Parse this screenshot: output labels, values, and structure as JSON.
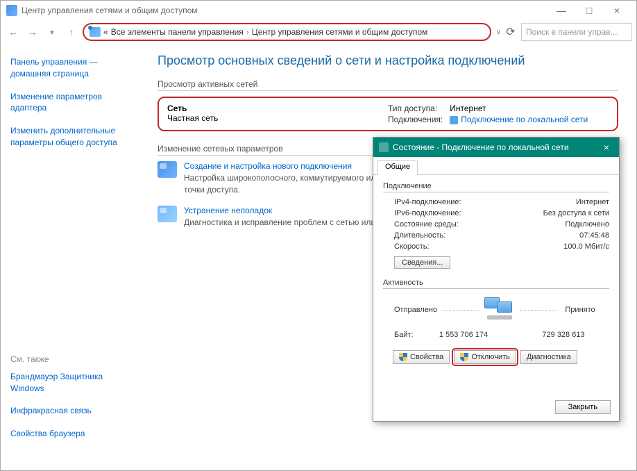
{
  "window": {
    "title": "Центр управления сетями и общим доступом",
    "minimize": "—",
    "maximize": "□",
    "close": "×"
  },
  "nav": {
    "back": "←",
    "forward": "→",
    "up": "↑",
    "more": "«",
    "crumb1": "Все элементы панели управления",
    "crumb2": "Центр управления сетями и общим доступом",
    "dropdown": "v",
    "refresh": "⟳",
    "search_placeholder": "Поиск в панели управ..."
  },
  "sidebar": {
    "link1": "Панель управления — домашняя страница",
    "link2": "Изменение параметров адаптера",
    "link3": "Изменить дополнительные параметры общего доступа",
    "seealso_hdr": "См. также",
    "seealso1": "Брандмауэр Защитника Windows",
    "seealso2": "Инфракрасная связь",
    "seealso3": "Свойства браузера"
  },
  "main": {
    "heading": "Просмотр основных сведений о сети и настройка подключений",
    "active_hdr": "Просмотр активных сетей",
    "net_name": "Сеть",
    "net_type": "Частная сеть",
    "access_lbl": "Тип доступа:",
    "access_val": "Интернет",
    "conn_lbl": "Подключения:",
    "conn_val": "Подключение по локальной сети",
    "change_hdr": "Изменение сетевых параметров",
    "task1_title": "Создание и настройка нового подключения",
    "task1_desc": "Настройка широкополосного, коммутируемого или VPN-подключения либо настройка маршрутизатора или точки доступа.",
    "task2_title": "Устранение неполадок",
    "task2_desc": "Диагностика и исправление проблем с сетью или получение сведений об устранении неполадок."
  },
  "dialog": {
    "title": "Состояние - Подключение по локальной сети",
    "tab": "Общие",
    "grp_conn": "Подключение",
    "ipv4_k": "IPv4-подключение:",
    "ipv4_v": "Интернет",
    "ipv6_k": "IPv6-подключение:",
    "ipv6_v": "Без доступа к сети",
    "media_k": "Состояние среды:",
    "media_v": "Подключено",
    "dur_k": "Длительность:",
    "dur_v": "07:45:48",
    "speed_k": "Скорость:",
    "speed_v": "100.0 Мбит/с",
    "details_btn": "Сведения...",
    "grp_act": "Активность",
    "sent_lbl": "Отправлено",
    "recv_lbl": "Принято",
    "bytes_lbl": "Байт:",
    "sent_val": "1 553 706 174",
    "recv_val": "729 328 613",
    "btn_props": "Свойства",
    "btn_disable": "Отключить",
    "btn_diag": "Диагностика",
    "btn_close": "Закрыть"
  }
}
